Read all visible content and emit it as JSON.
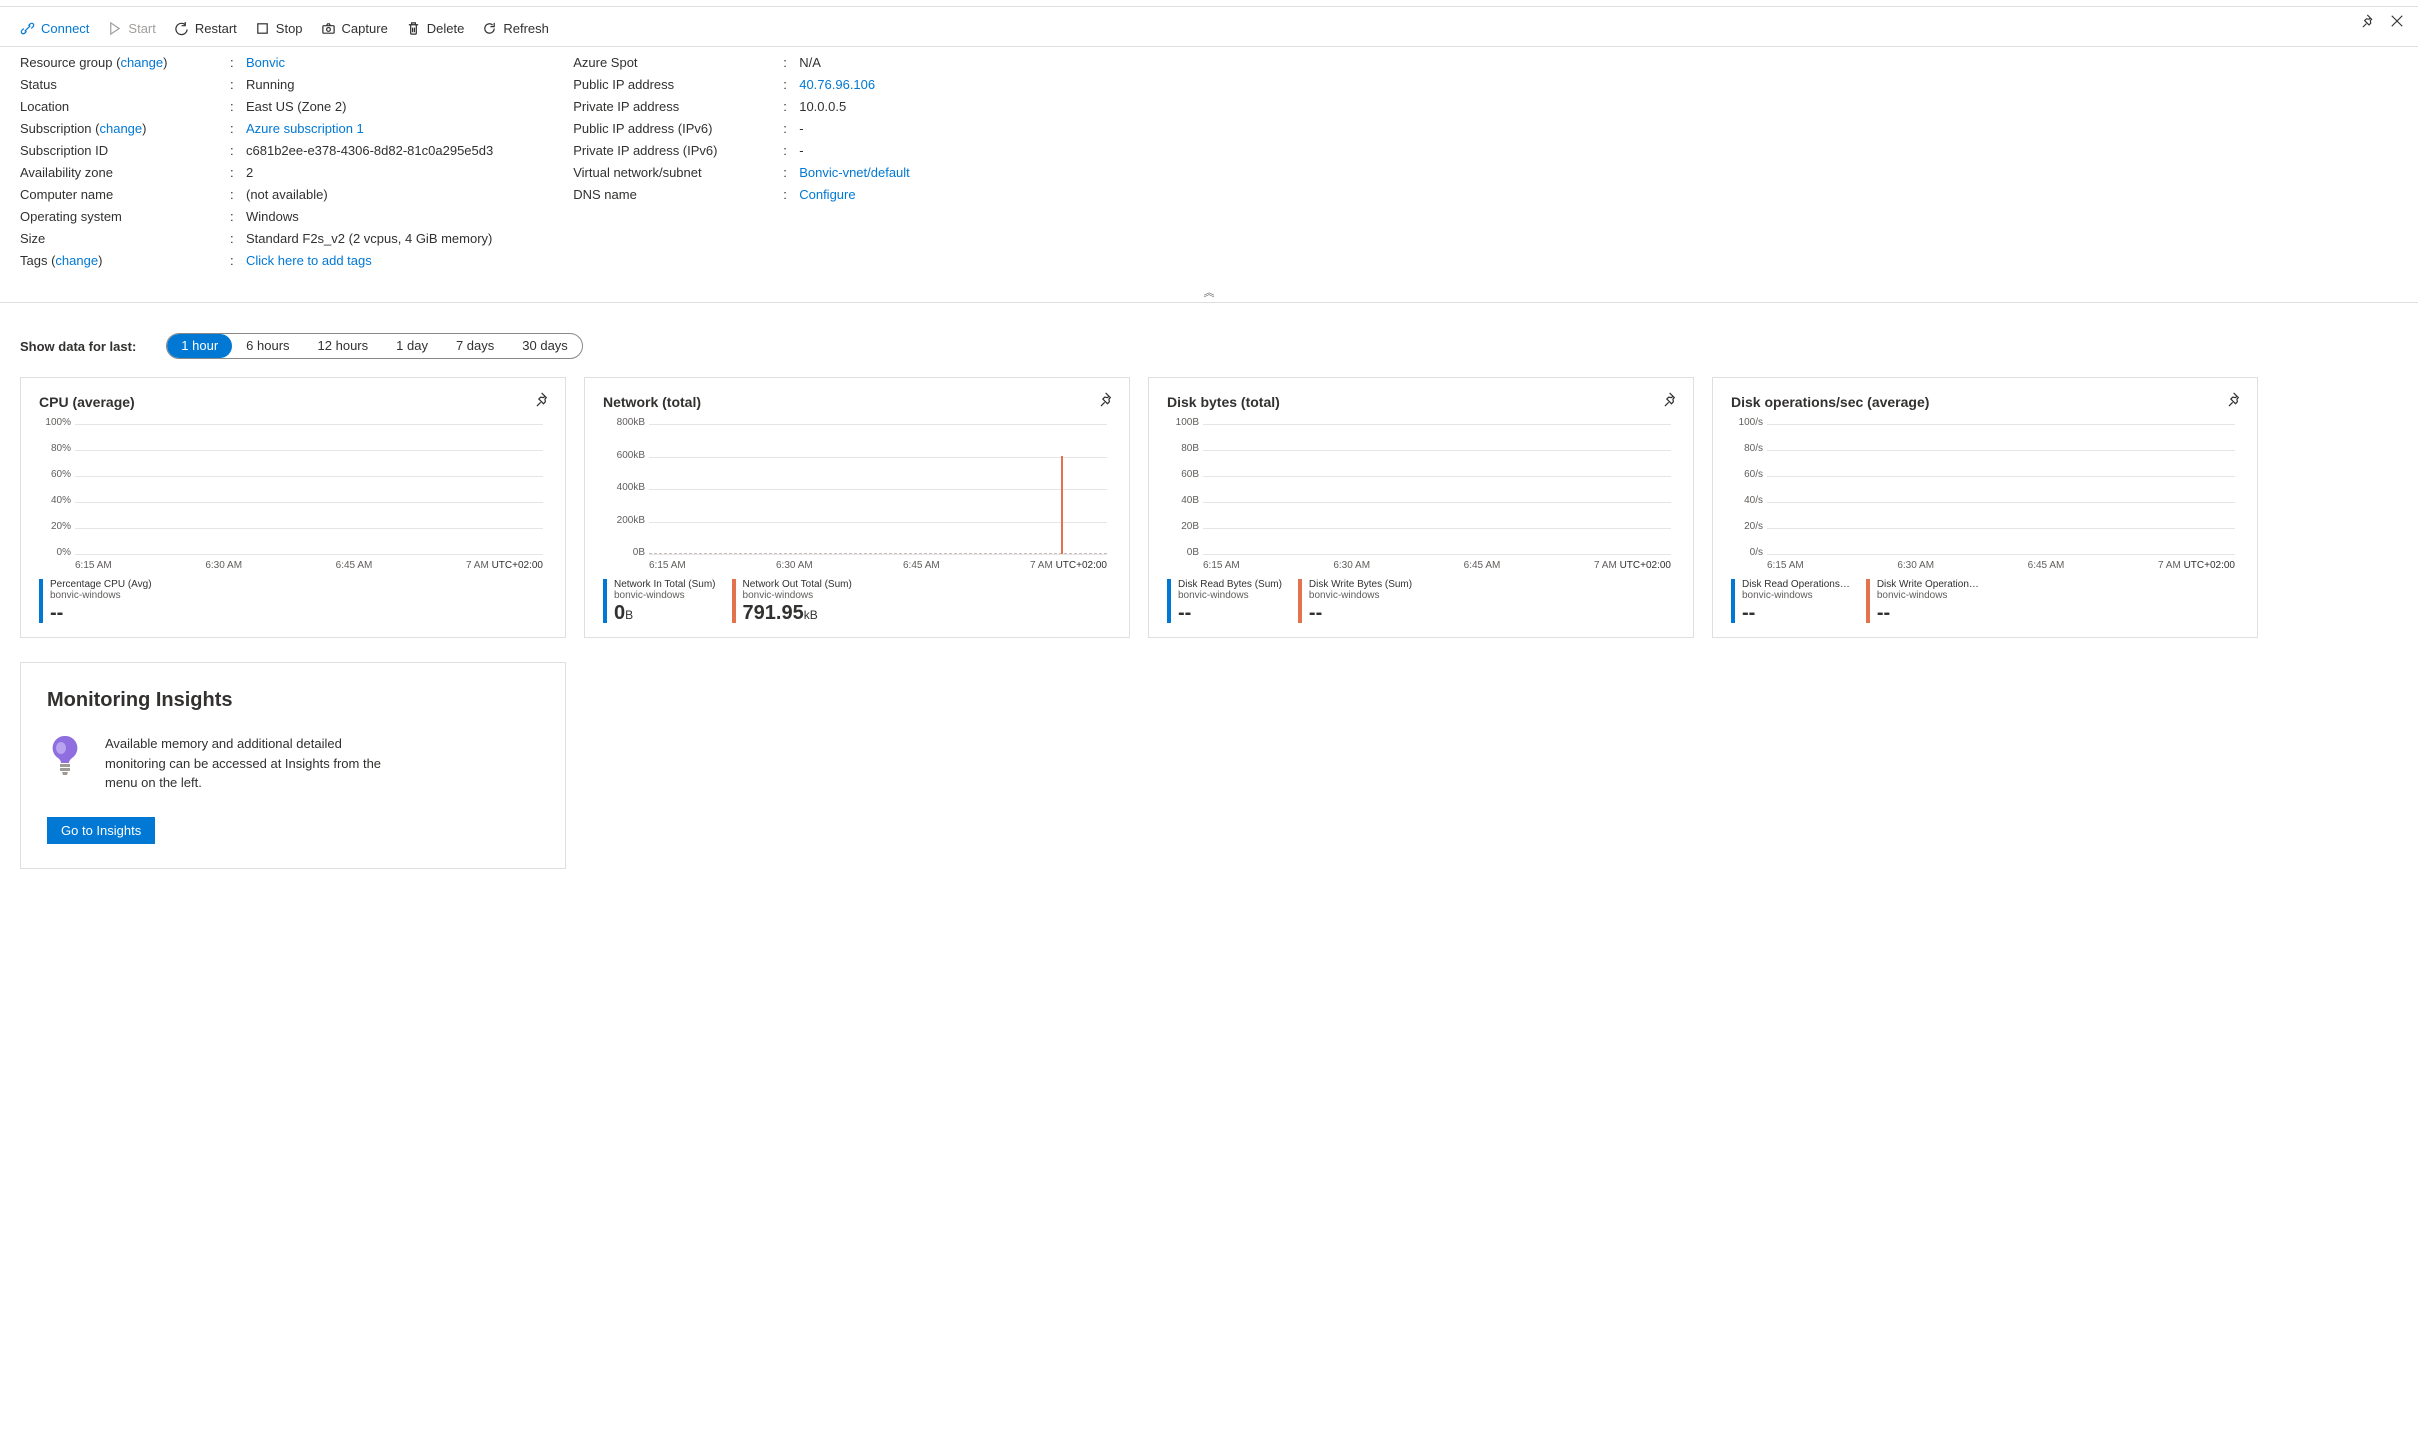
{
  "toolbar": {
    "connect": "Connect",
    "start": "Start",
    "restart": "Restart",
    "stop": "Stop",
    "capture": "Capture",
    "delete": "Delete",
    "refresh": "Refresh"
  },
  "propsLeft": [
    {
      "label": "Resource group (",
      "linkInLabel": "change",
      "labelSuffix": ")",
      "value": "Bonvic",
      "valueIsLink": true
    },
    {
      "label": "Status",
      "value": "Running"
    },
    {
      "label": "Location",
      "value": "East US (Zone 2)"
    },
    {
      "label": "Subscription (",
      "linkInLabel": "change",
      "labelSuffix": ")",
      "value": "Azure subscription 1",
      "valueIsLink": true
    },
    {
      "label": "Subscription ID",
      "value": "c681b2ee-e378-4306-8d82-81c0a295e5d3"
    },
    {
      "label": "Availability zone",
      "value": "2"
    },
    {
      "label": "Computer name",
      "value": "(not available)"
    },
    {
      "label": "Operating system",
      "value": "Windows"
    },
    {
      "label": "Size",
      "value": "Standard F2s_v2 (2 vcpus, 4 GiB memory)"
    },
    {
      "label": "Tags (",
      "linkInLabel": "change",
      "labelSuffix": ")",
      "value": "Click here to add tags",
      "valueIsLink": true
    }
  ],
  "propsRight": [
    {
      "label": "Azure Spot",
      "value": "N/A"
    },
    {
      "label": "Public IP address",
      "value": "40.76.96.106",
      "valueIsLink": true
    },
    {
      "label": "Private IP address",
      "value": "10.0.0.5"
    },
    {
      "label": "Public IP address (IPv6)",
      "value": "-"
    },
    {
      "label": "Private IP address (IPv6)",
      "value": "-"
    },
    {
      "label": "Virtual network/subnet",
      "value": "Bonvic-vnet/default",
      "valueIsLink": true
    },
    {
      "label": "DNS name",
      "value": "Configure",
      "valueIsLink": true
    }
  ],
  "range": {
    "label": "Show data for last:",
    "options": [
      "1 hour",
      "6 hours",
      "12 hours",
      "1 day",
      "7 days",
      "30 days"
    ],
    "active": 0
  },
  "chartsCommon": {
    "x": [
      "6:15 AM",
      "6:30 AM",
      "6:45 AM",
      "7 AM"
    ],
    "tz": "UTC+02:00",
    "resource": "bonvic-windows"
  },
  "charts": [
    {
      "title": "CPU (average)",
      "yticks": [
        "100%",
        "80%",
        "60%",
        "40%",
        "20%",
        "0%"
      ],
      "wide": false,
      "series": [
        {
          "name": "Percentage CPU (Avg)",
          "color": "blue",
          "value": "--"
        }
      ]
    },
    {
      "title": "Network (total)",
      "yticks": [
        "800kB",
        "600kB",
        "400kB",
        "200kB",
        "0B"
      ],
      "wide": true,
      "spike": true,
      "dashed": true,
      "series": [
        {
          "name": "Network In Total (Sum)",
          "color": "blue",
          "value": "0",
          "unit": "B"
        },
        {
          "name": "Network Out Total (Sum)",
          "color": "orange",
          "value": "791.95",
          "unit": "kB"
        }
      ]
    },
    {
      "title": "Disk bytes (total)",
      "yticks": [
        "100B",
        "80B",
        "60B",
        "40B",
        "20B",
        "0B"
      ],
      "wide": false,
      "series": [
        {
          "name": "Disk Read Bytes (Sum)",
          "color": "blue",
          "value": "--"
        },
        {
          "name": "Disk Write Bytes (Sum)",
          "color": "orange",
          "value": "--"
        }
      ]
    },
    {
      "title": "Disk operations/sec (average)",
      "yticks": [
        "100/s",
        "80/s",
        "60/s",
        "40/s",
        "20/s",
        "0/s"
      ],
      "wide": false,
      "series": [
        {
          "name": "Disk Read Operations…",
          "color": "blue",
          "value": "--"
        },
        {
          "name": "Disk Write Operation…",
          "color": "orange",
          "value": "--"
        }
      ]
    }
  ],
  "insights": {
    "title": "Monitoring Insights",
    "text": "Available memory and additional detailed monitoring can be accessed at Insights from the menu on the left.",
    "button": "Go to Insights"
  },
  "chart_data": {
    "type": "line",
    "x": [
      "6:15 AM",
      "6:30 AM",
      "6:45 AM",
      "7 AM"
    ],
    "tz": "UTC+02:00",
    "charts": [
      {
        "title": "CPU (average)",
        "ylim": [
          0,
          100
        ],
        "yunit": "%",
        "series": [
          {
            "name": "Percentage CPU (Avg)",
            "values": [
              null,
              null,
              null,
              null
            ],
            "summary": null
          }
        ]
      },
      {
        "title": "Network (total)",
        "ylim": [
          0,
          800
        ],
        "yunit": "kB",
        "series": [
          {
            "name": "Network In Total (Sum)",
            "values": [
              0,
              0,
              0,
              0
            ],
            "summary": 0,
            "summary_unit": "B"
          },
          {
            "name": "Network Out Total (Sum)",
            "values": [
              0,
              0,
              0,
              791.95
            ],
            "summary": 791.95,
            "summary_unit": "kB"
          }
        ]
      },
      {
        "title": "Disk bytes (total)",
        "ylim": [
          0,
          100
        ],
        "yunit": "B",
        "series": [
          {
            "name": "Disk Read Bytes (Sum)",
            "values": [
              null,
              null,
              null,
              null
            ],
            "summary": null
          },
          {
            "name": "Disk Write Bytes (Sum)",
            "values": [
              null,
              null,
              null,
              null
            ],
            "summary": null
          }
        ]
      },
      {
        "title": "Disk operations/sec (average)",
        "ylim": [
          0,
          100
        ],
        "yunit": "/s",
        "series": [
          {
            "name": "Disk Read Operations/Sec (Avg)",
            "values": [
              null,
              null,
              null,
              null
            ],
            "summary": null
          },
          {
            "name": "Disk Write Operations/Sec (Avg)",
            "values": [
              null,
              null,
              null,
              null
            ],
            "summary": null
          }
        ]
      }
    ]
  }
}
